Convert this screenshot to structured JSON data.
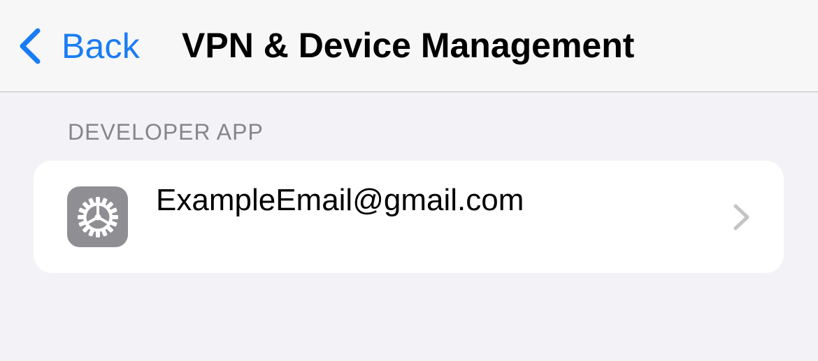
{
  "navbar": {
    "back_label": "Back",
    "back_icon": "chevron-left-icon",
    "title": "VPN & Device Management"
  },
  "section": {
    "header": "DEVELOPER APP",
    "rows": [
      {
        "label": "ExampleEmail@gmail.com",
        "icon": "settings-gear-icon",
        "accessory": "chevron-right-icon"
      }
    ]
  },
  "colors": {
    "accent": "#1a7cf5",
    "background": "#f2f2f7",
    "navbar_background": "#f7f7f8",
    "card_background": "#ffffff",
    "secondary_text": "#85858a",
    "icon_background": "#8e8e93",
    "chevron": "#c4c4c7"
  }
}
